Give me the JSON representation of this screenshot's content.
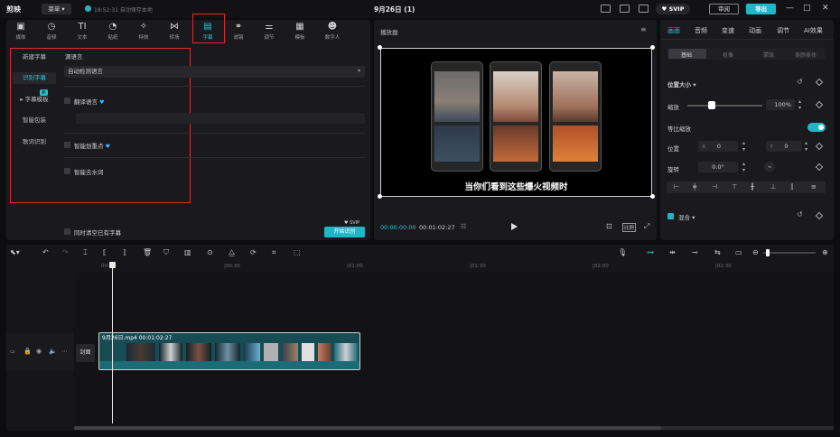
{
  "titlebar": {
    "app_name": "剪映",
    "menu_label": "菜单 ▾",
    "save_status": "18:52:31 自动保存本地",
    "project_title": "9月26日 (1)",
    "vip_label": "♥ SVIP",
    "review_label": "审阅",
    "export_label": "导出",
    "minimize": "—",
    "maximize": "□",
    "close": "✕"
  },
  "toolbox": {
    "tools": [
      {
        "label": "媒体",
        "icon": "media-icon"
      },
      {
        "label": "音频",
        "icon": "audio-icon"
      },
      {
        "label": "文本",
        "icon": "text-icon"
      },
      {
        "label": "贴纸",
        "icon": "sticker-icon"
      },
      {
        "label": "特效",
        "icon": "effects-icon"
      },
      {
        "label": "转场",
        "icon": "transition-icon"
      },
      {
        "label": "字幕",
        "icon": "caption-icon"
      },
      {
        "label": "滤镜",
        "icon": "filter-icon"
      },
      {
        "label": "调节",
        "icon": "adjust-icon"
      },
      {
        "label": "模板",
        "icon": "template-icon"
      },
      {
        "label": "数字人",
        "icon": "avatar-icon"
      }
    ],
    "active_tool": "字幕"
  },
  "caption_panel": {
    "side_items": [
      "新建字幕",
      "识别字幕",
      "字幕模板",
      "智能包装",
      "歌词识别"
    ],
    "side_badge": "新",
    "source_lang_label": "源语言",
    "source_lang_value": "自动检测语言",
    "translate_label": "翻译语言",
    "smart_emphasis_label": "智能划重点",
    "remove_filler_label": "智能去水词",
    "clear_existing_label": "同时清空已有字幕",
    "start_button": "开始识别",
    "vip_tag": "♥ SVIP"
  },
  "player": {
    "title": "播放器",
    "subtitle_text": "当你们看到这些爆火视频时",
    "time_current": "00:00:00:00",
    "time_total": "00:01:02:27",
    "ratio_label": "比例"
  },
  "properties": {
    "tabs": [
      "画面",
      "音频",
      "变速",
      "动画",
      "调节",
      "AI效果"
    ],
    "active_tab": "画面",
    "subtabs": [
      "基础",
      "抠像",
      "蒙版",
      "美颜美体"
    ],
    "active_subtab": "基础",
    "position_size_label": "位置大小",
    "scale_label": "缩放",
    "scale_value": "100%",
    "uniform_scale_label": "等比缩放",
    "position_label": "位置",
    "pos_x_label": "X",
    "pos_x_value": "0",
    "pos_y_label": "Y",
    "pos_y_value": "0",
    "rotate_label": "旋转",
    "rotate_value": "0.0°",
    "blend_label": "混合",
    "scale_fraction": 0.3,
    "accent_color": "#1fb7c8"
  },
  "timeline": {
    "ticks": [
      "00:00",
      "|00:30",
      "|01:00",
      "|01:30",
      "|02:00",
      "|02:30"
    ],
    "cover_label": "封面",
    "clip_label": "9月26日.mp4  00:01:02:27"
  }
}
